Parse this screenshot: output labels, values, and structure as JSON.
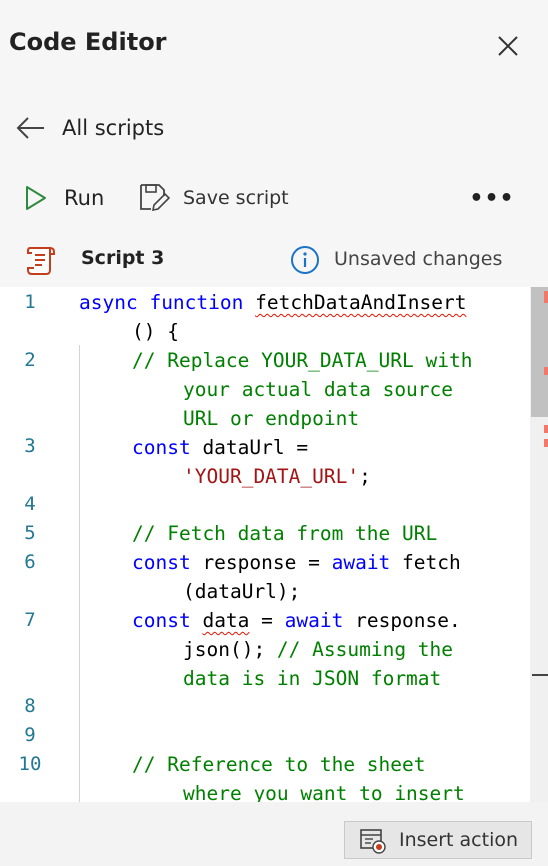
{
  "header": {
    "title": "Code Editor",
    "close_label": "Close"
  },
  "nav": {
    "back_label": "All scripts"
  },
  "toolbar": {
    "run_label": "Run",
    "save_label": "Save script",
    "more_label": "•••"
  },
  "script": {
    "name": "Script 3",
    "status": "Unsaved changes"
  },
  "editor": {
    "line_numbers": [
      "1",
      "2",
      "3",
      "4",
      "5",
      "6",
      "7",
      "8",
      "9",
      "10"
    ],
    "code": {
      "l1_kw1": "async",
      "l1_kw2": "function",
      "l1_name": "fetchDataAndInsert",
      "l1_cont": "() {",
      "l2_c1": "// Replace YOUR_DATA_URL with",
      "l2_c2": "your actual data source",
      "l2_c3": "URL or endpoint",
      "l3_kw": "const",
      "l3_rest": " dataUrl =",
      "l3_str": "'YOUR_DATA_URL'",
      "l3_end": ";",
      "l5_c": "// Fetch data from the URL",
      "l6_kw": "const",
      "l6_mid": " response = ",
      "l6_kw2": "await",
      "l6_end": " fetch",
      "l6_cont": "(dataUrl);",
      "l7_kw": "const",
      "l7_sp": " ",
      "l7_var": "data",
      "l7_mid": " = ",
      "l7_kw2": "await",
      "l7_end": " response.",
      "l7_cont_a": "json(); ",
      "l7_cont_c": "// Assuming the",
      "l7_cont2": "data is in JSON format",
      "l10_c1": "// Reference to the sheet",
      "l10_c2": "where you want to insert"
    }
  },
  "footer": {
    "insert_label": "Insert action"
  },
  "colors": {
    "keyword": "#0000ff",
    "comment": "#008000",
    "string": "#a31515",
    "line_number": "#237893",
    "error": "#e51400"
  }
}
